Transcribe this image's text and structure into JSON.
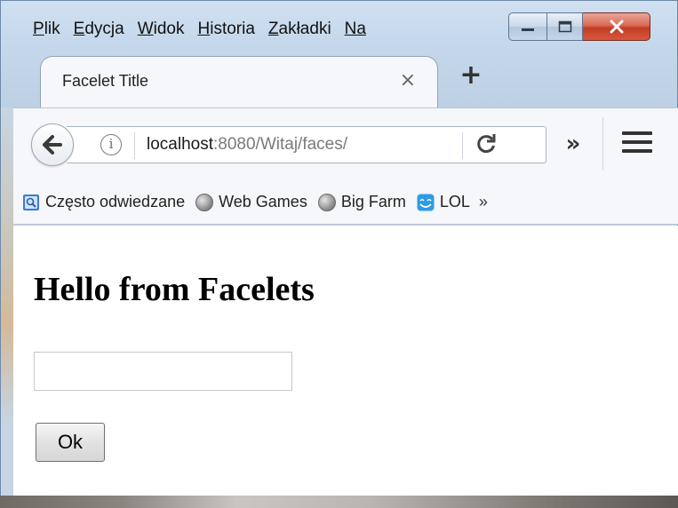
{
  "menubar": {
    "items": [
      {
        "accel": "P",
        "rest": "lik"
      },
      {
        "accel": "E",
        "rest": "dycja"
      },
      {
        "accel": "W",
        "rest": "idok"
      },
      {
        "accel": "H",
        "rest": "istoria"
      },
      {
        "accel": "Z",
        "rest": "akładki"
      },
      {
        "accel": "Na",
        "rest": ""
      }
    ]
  },
  "tab": {
    "title": "Facelet Title",
    "close_glyph": "×",
    "new_tab_glyph": "+"
  },
  "navbar": {
    "url_host": "localhost",
    "url_path": ":8080/Witaj/faces/",
    "overflow_glyph": "»"
  },
  "bookmarks": {
    "items": [
      {
        "label": "Często odwiedzane",
        "icon": "frequent-icon"
      },
      {
        "label": "Web Games",
        "icon": "globe-icon"
      },
      {
        "label": "Big Farm",
        "icon": "globe-icon"
      },
      {
        "label": "LOL",
        "icon": "smiley-icon"
      }
    ],
    "more_glyph": "»"
  },
  "page": {
    "heading": "Hello from Facelets",
    "input_value": "",
    "ok_label": "Ok"
  },
  "colors": {
    "close_button": "#c43b23",
    "frame": "#c3d6ea",
    "content_bg": "#ffffff"
  }
}
